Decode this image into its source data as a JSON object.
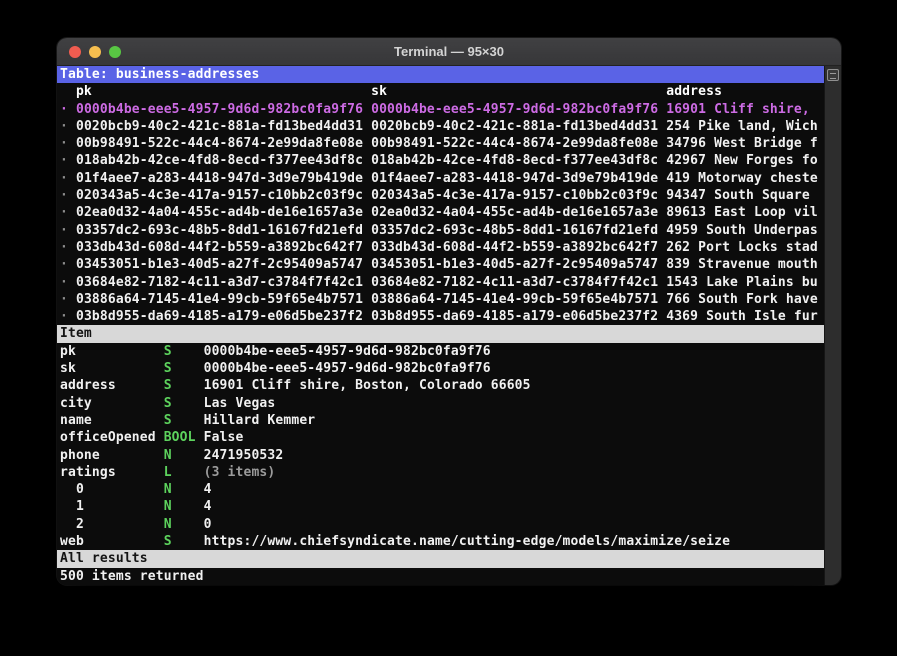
{
  "window": {
    "title": "Terminal — 95×30",
    "traffic_buttons": [
      "close",
      "minimize",
      "zoom"
    ]
  },
  "colors": {
    "accent_blue": "#5a63e6",
    "magenta": "#cd6be4",
    "green": "#5dd35d",
    "gray": "#9b9b9b",
    "bar_light": "#d8d8d8",
    "traffic_red": "#f05c50",
    "traffic_yellow": "#f6be4f",
    "traffic_green": "#58c643"
  },
  "table": {
    "header_label": "Table: business-addresses",
    "columns": [
      "pk",
      "sk",
      "address"
    ],
    "rows": [
      {
        "pk": "0000b4be-eee5-4957-9d6d-982bc0fa9f76",
        "sk": "0000b4be-eee5-4957-9d6d-982bc0fa9f76",
        "address": "16901 Cliff shire,",
        "selected": true
      },
      {
        "pk": "0020bcb9-40c2-421c-881a-fd13bed4dd31",
        "sk": "0020bcb9-40c2-421c-881a-fd13bed4dd31",
        "address": "254 Pike land, Wich",
        "selected": false
      },
      {
        "pk": "00b98491-522c-44c4-8674-2e99da8fe08e",
        "sk": "00b98491-522c-44c4-8674-2e99da8fe08e",
        "address": "34796 West Bridge f",
        "selected": false
      },
      {
        "pk": "018ab42b-42ce-4fd8-8ecd-f377ee43df8c",
        "sk": "018ab42b-42ce-4fd8-8ecd-f377ee43df8c",
        "address": "42967 New Forges fo",
        "selected": false
      },
      {
        "pk": "01f4aee7-a283-4418-947d-3d9e79b419de",
        "sk": "01f4aee7-a283-4418-947d-3d9e79b419de",
        "address": "419 Motorway cheste",
        "selected": false
      },
      {
        "pk": "020343a5-4c3e-417a-9157-c10bb2c03f9c",
        "sk": "020343a5-4c3e-417a-9157-c10bb2c03f9c",
        "address": "94347 South Square",
        "selected": false
      },
      {
        "pk": "02ea0d32-4a04-455c-ad4b-de16e1657a3e",
        "sk": "02ea0d32-4a04-455c-ad4b-de16e1657a3e",
        "address": "89613 East Loop vil",
        "selected": false
      },
      {
        "pk": "03357dc2-693c-48b5-8dd1-16167fd21efd",
        "sk": "03357dc2-693c-48b5-8dd1-16167fd21efd",
        "address": "4959 South Underpas",
        "selected": false
      },
      {
        "pk": "033db43d-608d-44f2-b559-a3892bc642f7",
        "sk": "033db43d-608d-44f2-b559-a3892bc642f7",
        "address": "262 Port Locks stad",
        "selected": false
      },
      {
        "pk": "03453051-b1e3-40d5-a27f-2c95409a5747",
        "sk": "03453051-b1e3-40d5-a27f-2c95409a5747",
        "address": "839 Stravenue mouth",
        "selected": false
      },
      {
        "pk": "03684e82-7182-4c11-a3d7-c3784f7f42c1",
        "sk": "03684e82-7182-4c11-a3d7-c3784f7f42c1",
        "address": "1543 Lake Plains bu",
        "selected": false
      },
      {
        "pk": "03886a64-7145-41e4-99cb-59f65e4b7571",
        "sk": "03886a64-7145-41e4-99cb-59f65e4b7571",
        "address": "766 South Fork have",
        "selected": false
      },
      {
        "pk": "03b8d955-da69-4185-a179-e06d5be237f2",
        "sk": "03b8d955-da69-4185-a179-e06d5be237f2",
        "address": "4369 South Isle fur",
        "selected": false
      }
    ],
    "bullet_glyph": "·"
  },
  "item": {
    "header_label": "Item",
    "attributes": [
      {
        "name": "pk",
        "type": "S",
        "value": "0000b4be-eee5-4957-9d6d-982bc0fa9f76",
        "indent": 0,
        "muted": false
      },
      {
        "name": "sk",
        "type": "S",
        "value": "0000b4be-eee5-4957-9d6d-982bc0fa9f76",
        "indent": 0,
        "muted": false
      },
      {
        "name": "address",
        "type": "S",
        "value": "16901 Cliff shire, Boston, Colorado 66605",
        "indent": 0,
        "muted": false
      },
      {
        "name": "city",
        "type": "S",
        "value": "Las Vegas",
        "indent": 0,
        "muted": false
      },
      {
        "name": "name",
        "type": "S",
        "value": "Hillard Kemmer",
        "indent": 0,
        "muted": false
      },
      {
        "name": "officeOpened",
        "type": "BOOL",
        "value": "False",
        "indent": 0,
        "muted": false
      },
      {
        "name": "phone",
        "type": "N",
        "value": "2471950532",
        "indent": 0,
        "muted": false
      },
      {
        "name": "ratings",
        "type": "L",
        "value": "(3 items)",
        "indent": 0,
        "muted": true
      },
      {
        "name": "0",
        "type": "N",
        "value": "4",
        "indent": 1,
        "muted": false
      },
      {
        "name": "1",
        "type": "N",
        "value": "4",
        "indent": 1,
        "muted": false
      },
      {
        "name": "2",
        "type": "N",
        "value": "0",
        "indent": 1,
        "muted": false
      },
      {
        "name": "web",
        "type": "S",
        "value": "https://www.chiefsyndicate.name/cutting-edge/models/maximize/seize",
        "indent": 0,
        "muted": false
      }
    ]
  },
  "footer": {
    "results_label": "All results",
    "status": "500 items returned"
  }
}
